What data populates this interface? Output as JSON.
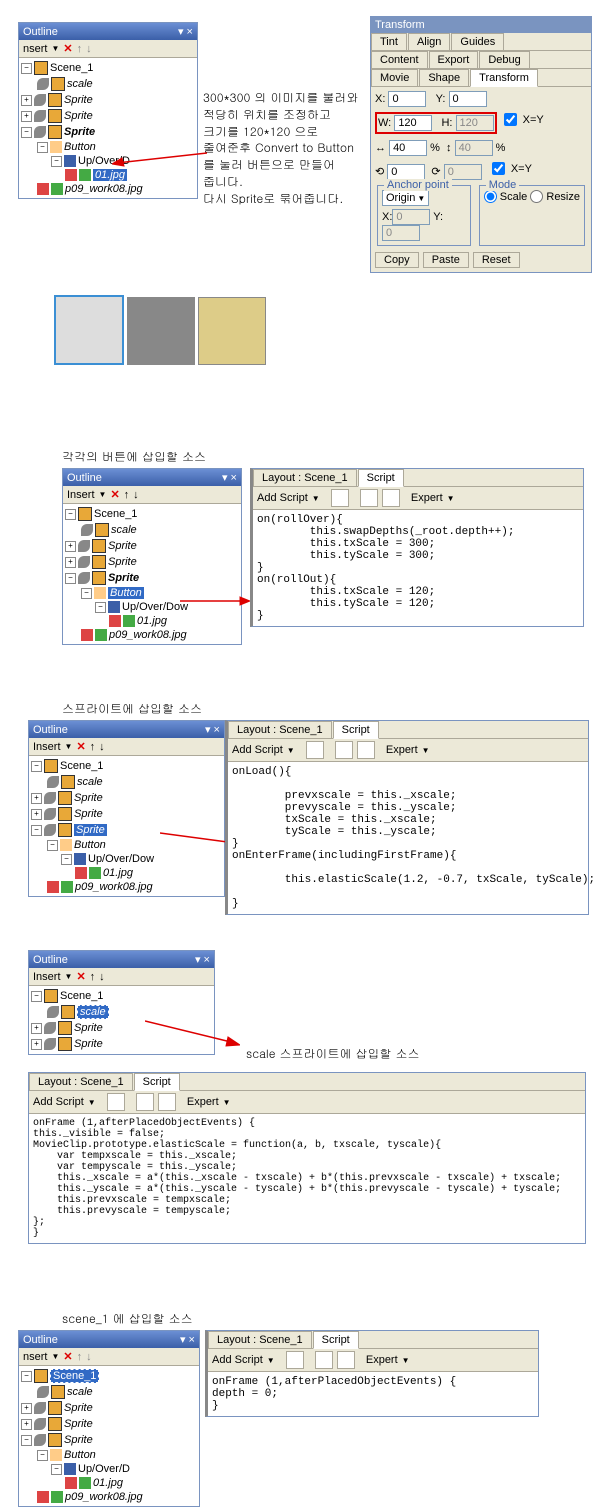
{
  "section1": {
    "outline": {
      "title": "Outline",
      "insert": "nsert",
      "tree": {
        "scene": "Scene_1",
        "scale": "scale",
        "sprite": "Sprite",
        "button": "Button",
        "upover": "Up/Over/D",
        "img": "01.jpg",
        "work": "p09_work08.jpg"
      }
    },
    "note": "300*300 의 이미지를 불러와\n적당히 위치를 조정하고\n크기를 120*120 으로\n줄여준후 Convert to Button\n를 눌러 버튼으로 만들어\n줍니다.\n다시 Sprite로 묶어줍니다.",
    "transform": {
      "title": "Transform",
      "tabs": {
        "tint": "Tint",
        "align": "Align",
        "guides": "Guides",
        "content": "Content",
        "export": "Export",
        "debug": "Debug",
        "movie": "Movie",
        "shape": "Shape",
        "transform": "Transform"
      },
      "x": "X:",
      "xv": "0",
      "y": "Y:",
      "yv": "0",
      "w": "W:",
      "wv": "120",
      "h": "H:",
      "hv": "120",
      "sw": "40",
      "sh": "40",
      "rot1": "0",
      "rot2": "0",
      "xeq": "X=Y",
      "yeq": "X=Y",
      "anchor": "Anchor point",
      "origin": "Origin",
      "ax": "X:",
      "axv": "0",
      "ay": "Y:",
      "ayv": "0",
      "mode": "Mode",
      "scale": "Scale",
      "resize": "Resize",
      "copy": "Copy",
      "paste": "Paste",
      "reset": "Reset",
      "pct": "%"
    }
  },
  "section2": {
    "caption": "각각의 버튼에 삽입할 소스",
    "outline": {
      "title": "Outline",
      "insert": "Insert",
      "tree": {
        "scene": "Scene_1",
        "scale": "scale",
        "sprite": "Sprite",
        "button": "Button",
        "upover": "Up/Over/Dow",
        "img": "01.jpg",
        "work": "p09_work08.jpg"
      }
    },
    "script": {
      "layout": "Layout : Scene_1",
      "tab": "Script",
      "add": "Add Script",
      "expert": "Expert",
      "code": "on(rollOver){\n        this.swapDepths(_root.depth++);\n        this.txScale = 300;\n        this.tyScale = 300;\n}\non(rollOut){\n        this.txScale = 120;\n        this.tyScale = 120;\n}"
    }
  },
  "section3": {
    "caption": "스프라이트에 삽입할 소스",
    "outline": {
      "title": "Outline",
      "insert": "Insert",
      "tree": {
        "scene": "Scene_1",
        "scale": "scale",
        "sprite": "Sprite",
        "button": "Button",
        "upover": "Up/Over/Dow",
        "img": "01.jpg",
        "work": "p09_work08.jpg"
      }
    },
    "script": {
      "layout": "Layout : Scene_1",
      "tab": "Script",
      "add": "Add Script",
      "expert": "Expert",
      "code": "onLoad(){\n\n        prevxscale = this._xscale;\n        prevyscale = this._yscale;\n        txScale = this._xscale;\n        tyScale = this._yscale;\n}\nonEnterFrame(includingFirstFrame){\n\n        this.elasticScale(1.2, -0.7, txScale, tyScale);\n\n}"
    }
  },
  "section4": {
    "outline": {
      "title": "Outline",
      "insert": "Insert",
      "tree": {
        "scene": "Scene_1",
        "scale": "scale",
        "sprite": "Sprite"
      }
    },
    "caption": "scale 스프라이트에 삽입할 소스",
    "script": {
      "layout": "Layout : Scene_1",
      "tab": "Script",
      "add": "Add Script",
      "expert": "Expert",
      "code": "onFrame (1,afterPlacedObjectEvents) {\nthis._visible = false;\nMovieClip.prototype.elasticScale = function(a, b, txscale, tyscale){\n    var tempxscale = this._xscale;\n    var tempyscale = this._yscale;\n    this._xscale = a*(this._xscale - txscale) + b*(this.prevxscale - txscale) + txscale;\n    this._yscale = a*(this._yscale - tyscale) + b*(this.prevyscale - tyscale) + tyscale;\n    this.prevxscale = tempxscale;\n    this.prevyscale = tempyscale;\n};\n}"
    }
  },
  "section5": {
    "caption": "scene_1 에 삽입할 소스",
    "outline": {
      "title": "Outline",
      "insert": "nsert",
      "tree": {
        "scene": "Scene_1",
        "scale": "scale",
        "sprite": "Sprite",
        "button": "Button",
        "upover": "Up/Over/D",
        "img": "01.jpg",
        "work": "p09_work08.jpg"
      }
    },
    "script": {
      "layout": "Layout : Scene_1",
      "tab": "Script",
      "add": "Add Script",
      "expert": "Expert",
      "code": "onFrame (1,afterPlacedObjectEvents) {\ndepth = 0;\n}"
    }
  }
}
